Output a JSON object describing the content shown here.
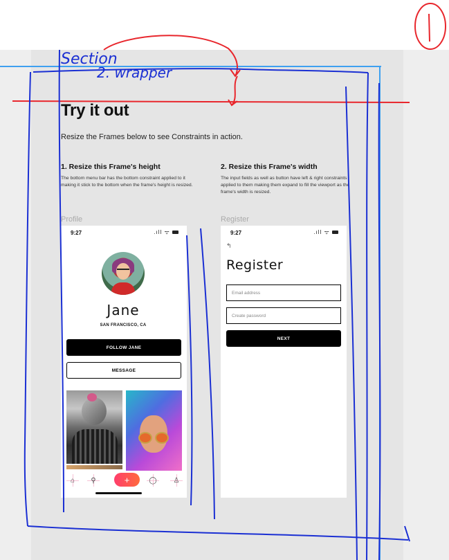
{
  "canvas": {
    "section_color": "#e5e5e5",
    "guide_color": "#3ea0f0",
    "annotation_colors": {
      "red": "#e8262c",
      "blue": "#1a2fd3"
    }
  },
  "header": {
    "title": "Try it out",
    "subtitle": "Resize the Frames below to see Constraints in action."
  },
  "steps": [
    {
      "title": "1. Resize this Frame's height",
      "description": "The bottom menu bar has the bottom constraint applied to it making it stick to the bottom when the frame's height is resized."
    },
    {
      "title": "2. Resize this Frame's width",
      "description": "The input fields as well as button have left & right constraints applied to them making them expand to fill the viewport as the frame's width is resized."
    }
  ],
  "profile_frame": {
    "label": "Profile",
    "status_time": "9:27",
    "status_icons": ".ıll ᯤ",
    "name": "Jane",
    "location": "SAN FRANCISCO, CA",
    "follow_button": "FOLLOW JANE",
    "message_button": "MESSAGE",
    "tabs": [
      {
        "icon": "home-icon",
        "glyph": "⌂"
      },
      {
        "icon": "search-icon",
        "glyph": "⚲"
      },
      {
        "icon": "add-icon",
        "glyph": "+"
      },
      {
        "icon": "chat-icon",
        "glyph": "◯"
      },
      {
        "icon": "user-icon",
        "glyph": "♙"
      }
    ]
  },
  "register_frame": {
    "label": "Register",
    "status_time": "9:27",
    "status_icons": ".ıll ᯤ",
    "back_glyph": "↰",
    "title": "Register",
    "email_placeholder": "Email address",
    "password_placeholder": "Create password",
    "next_button": "NEXT"
  },
  "annotations": {
    "number": "1",
    "word1": "Section",
    "word2": "2. wrapper"
  }
}
